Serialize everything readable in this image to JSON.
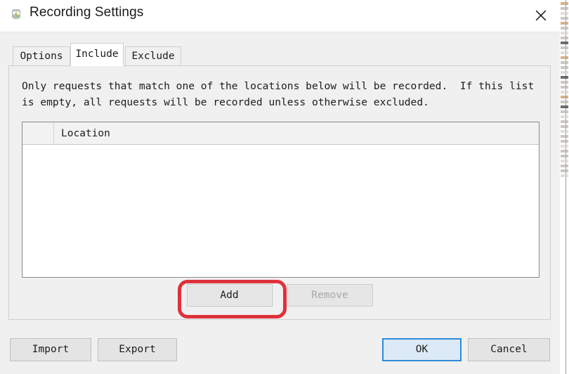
{
  "window": {
    "title": "Recording Settings",
    "icon": "zap-jar-icon",
    "close_label": "×"
  },
  "tabs": [
    {
      "label": "Options",
      "active": false
    },
    {
      "label": "Include",
      "active": true
    },
    {
      "label": "Exclude",
      "active": false
    }
  ],
  "include_panel": {
    "description": "Only requests that match one of the locations below will be recorded.  If this list is empty, all requests will be recorded unless otherwise excluded.",
    "table": {
      "columns": [
        "",
        "Location"
      ],
      "rows": []
    },
    "add_label": "Add",
    "remove_label": "Remove",
    "remove_enabled": false
  },
  "footer": {
    "import_label": "Import",
    "export_label": "Export",
    "ok_label": "OK",
    "cancel_label": "Cancel"
  },
  "annotation": {
    "target": "add-button",
    "color": "#e0313b",
    "shape": "rounded-rectangle"
  },
  "colors": {
    "dialog_bg": "#f0f0f0",
    "titlebar_bg": "#ffffff",
    "table_bg": "#ffffff",
    "default_button_bg": "#dceaf7",
    "default_button_border": "#2f8ad6",
    "annotation": "#e0313b"
  }
}
